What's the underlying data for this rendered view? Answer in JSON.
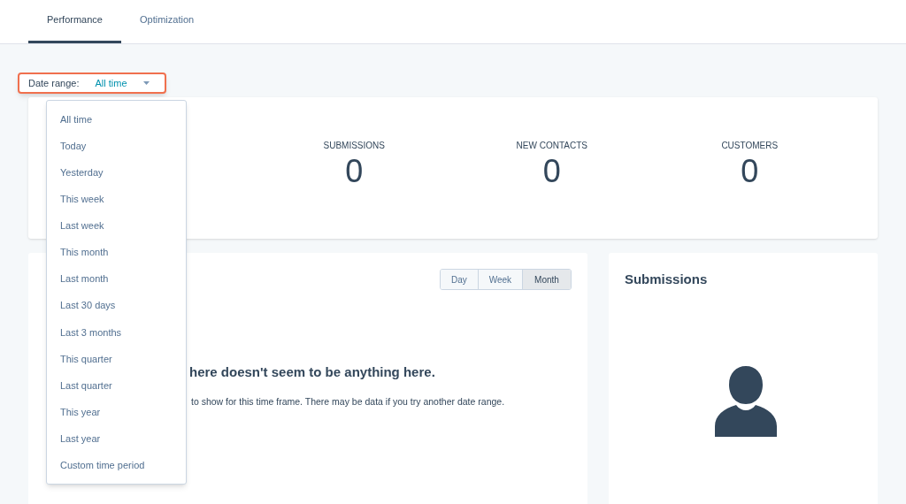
{
  "tabs": [
    {
      "label": "Performance",
      "selected": true
    },
    {
      "label": "Optimization",
      "selected": false
    }
  ],
  "date_range": {
    "label": "Date range:",
    "value": "All time",
    "expanded": true
  },
  "date_options": [
    "All time",
    "Today",
    "Yesterday",
    "This week",
    "Last week",
    "This month",
    "Last month",
    "Last 30 days",
    "Last 3 months",
    "This quarter",
    "Last quarter",
    "This year",
    "Last year",
    "Custom time period"
  ],
  "stats": [
    {
      "label": "SUBMISSIONS",
      "value": "0"
    },
    {
      "label": "NEW CONTACTS",
      "value": "0"
    },
    {
      "label": "CUSTOMERS",
      "value": "0"
    }
  ],
  "interval_buttons": [
    {
      "label": "Day",
      "selected": false
    },
    {
      "label": "Week",
      "selected": false
    },
    {
      "label": "Month",
      "selected": true
    }
  ],
  "empty_state": {
    "title": "here doesn't seem to be anything here.",
    "text": "to show for this time frame. There may be data if you try another date range."
  },
  "submissions_card": {
    "title": "Submissions"
  }
}
